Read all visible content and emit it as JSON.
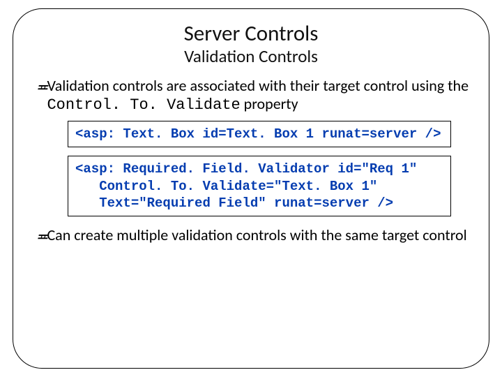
{
  "title": "Server Controls",
  "subtitle": "Validation Controls",
  "bullet_glyph": "≖",
  "bullets": [
    {
      "pre": "Validation controls are associated with their target control using the ",
      "code": "Control. To. Validate",
      "post": " property"
    },
    {
      "pre": "Can create multiple validation controls with the same target control",
      "code": "",
      "post": ""
    }
  ],
  "code_blocks": [
    "<asp: Text. Box id=Text. Box 1 runat=server />",
    "<asp: Required. Field. Validator id=\"Req 1\"\n   Control. To. Validate=\"Text. Box 1\"\n   Text=\"Required Field\" runat=server />"
  ]
}
